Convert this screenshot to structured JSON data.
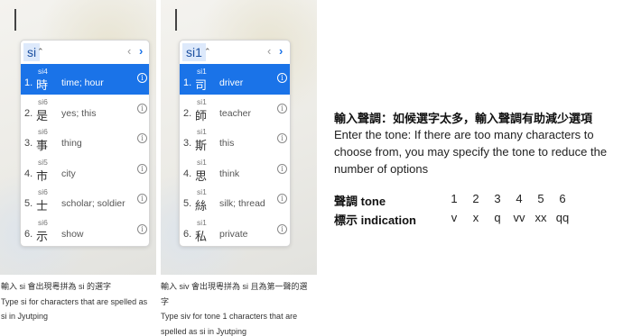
{
  "panel1": {
    "input": "si",
    "candidates": [
      {
        "num": "1.",
        "annot": "si4",
        "char": "時",
        "gloss": "time; hour",
        "selected": true
      },
      {
        "num": "2.",
        "annot": "si6",
        "char": "是",
        "gloss": "yes; this",
        "selected": false
      },
      {
        "num": "3.",
        "annot": "si6",
        "char": "事",
        "gloss": "thing",
        "selected": false
      },
      {
        "num": "4.",
        "annot": "si5",
        "char": "市",
        "gloss": "city",
        "selected": false
      },
      {
        "num": "5.",
        "annot": "si6",
        "char": "士",
        "gloss": "scholar; soldier",
        "selected": false
      },
      {
        "num": "6.",
        "annot": "si6",
        "char": "示",
        "gloss": "show",
        "selected": false
      }
    ],
    "caption": [
      "輸入 si 會出現粵拼為 si 的選字",
      "Type si for characters that are spelled as",
      "si in Jyutping"
    ]
  },
  "panel2": {
    "input": "si1",
    "candidates": [
      {
        "num": "1.",
        "annot": "si1",
        "char": "司",
        "gloss": "driver",
        "selected": true
      },
      {
        "num": "2.",
        "annot": "si1",
        "char": "師",
        "gloss": "teacher",
        "selected": false
      },
      {
        "num": "3.",
        "annot": "si1",
        "char": "斯",
        "gloss": "this",
        "selected": false
      },
      {
        "num": "4.",
        "annot": "si1",
        "char": "思",
        "gloss": "think",
        "selected": false
      },
      {
        "num": "5.",
        "annot": "si1",
        "char": "絲",
        "gloss": "silk; thread",
        "selected": false
      },
      {
        "num": "6.",
        "annot": "si1",
        "char": "私",
        "gloss": "private",
        "selected": false
      }
    ],
    "caption": [
      "輸入 siv 會出現粵拼為 si 且為第一聲的選",
      "字",
      "Type siv for tone 1 characters that are",
      "spelled as si in Jyutping"
    ]
  },
  "nav": {
    "prev": "‹",
    "next": "›",
    "up": "⌃",
    "info": "i"
  },
  "explain": {
    "heading": "輸入聲調：如候選字太多，輸入聲調有助減少選項",
    "description": "Enter the tone: If there are too many characters to choose from, you may specify the tone to reduce the number of options",
    "tone_label": "聲調 tone",
    "indication_label": "標示 indication",
    "tones": [
      "1",
      "2",
      "3",
      "4",
      "5",
      "6"
    ],
    "indications": [
      "v",
      "x",
      "q",
      "vv",
      "xx",
      "qq"
    ]
  },
  "colors": {
    "accent": "#1a73e8",
    "input_highlight": "#dde9fb"
  }
}
